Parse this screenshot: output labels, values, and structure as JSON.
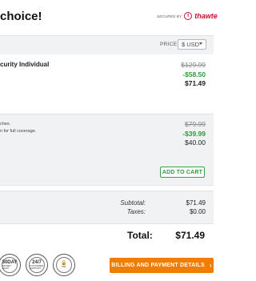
{
  "header": {
    "title": "choice!",
    "secured_by": "SECURED BY",
    "brand": "thawte"
  },
  "price_bar": {
    "label": "PRICE",
    "currency": "$ USD"
  },
  "products": [
    {
      "name": "curity Individual",
      "list_price": "$129.99",
      "discount": "-$58.50",
      "final_price": "$71.49"
    },
    {
      "lines": [
        "ches.",
        "n for full coverage."
      ],
      "list_price": "$79.99",
      "discount": "-$39.99",
      "final_price": "$40.00",
      "add_to_cart": "ADD TO CART"
    }
  ],
  "totals": {
    "subtotal_label": "Subtotal:",
    "subtotal_value": "$71.49",
    "taxes_label": "Taxes:",
    "taxes_value": "$0.00",
    "total_label": "Total:",
    "total_value": "$71.49"
  },
  "seals": [
    {
      "icon": "money-back-seal-icon",
      "main": "30DAY",
      "sub": "MONEY BACK"
    },
    {
      "icon": "support-seal-icon",
      "main": "24/7",
      "sub": "CUSTOMER SUPPORT"
    },
    {
      "icon": "ssl-lock-seal-icon",
      "main": "🔒",
      "sub": "SSL"
    }
  ],
  "checkout": {
    "button_label": "BILLING AND PAYMENT DETAILS",
    "chevron": "›"
  },
  "colors": {
    "accent_orange": "#f07d00",
    "discount_green": "#2e9b3e",
    "thawte_red": "#c8102e"
  }
}
